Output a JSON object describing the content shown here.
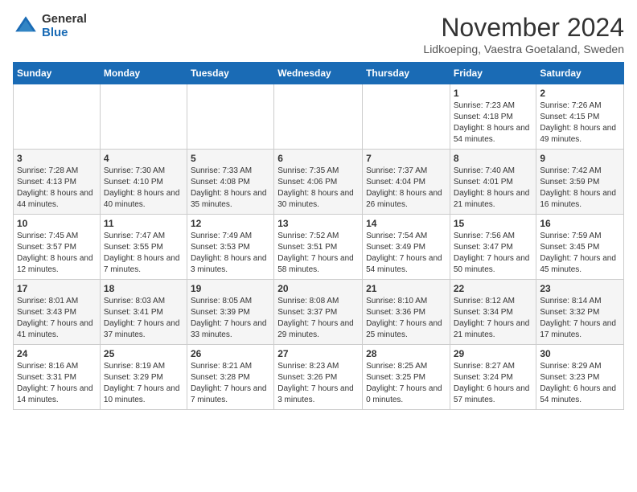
{
  "header": {
    "logo_general": "General",
    "logo_blue": "Blue",
    "title": "November 2024",
    "location": "Lidkoeping, Vaestra Goetaland, Sweden"
  },
  "weekdays": [
    "Sunday",
    "Monday",
    "Tuesday",
    "Wednesday",
    "Thursday",
    "Friday",
    "Saturday"
  ],
  "weeks": [
    [
      {
        "day": "",
        "info": ""
      },
      {
        "day": "",
        "info": ""
      },
      {
        "day": "",
        "info": ""
      },
      {
        "day": "",
        "info": ""
      },
      {
        "day": "",
        "info": ""
      },
      {
        "day": "1",
        "info": "Sunrise: 7:23 AM\nSunset: 4:18 PM\nDaylight: 8 hours and 54 minutes."
      },
      {
        "day": "2",
        "info": "Sunrise: 7:26 AM\nSunset: 4:15 PM\nDaylight: 8 hours and 49 minutes."
      }
    ],
    [
      {
        "day": "3",
        "info": "Sunrise: 7:28 AM\nSunset: 4:13 PM\nDaylight: 8 hours and 44 minutes."
      },
      {
        "day": "4",
        "info": "Sunrise: 7:30 AM\nSunset: 4:10 PM\nDaylight: 8 hours and 40 minutes."
      },
      {
        "day": "5",
        "info": "Sunrise: 7:33 AM\nSunset: 4:08 PM\nDaylight: 8 hours and 35 minutes."
      },
      {
        "day": "6",
        "info": "Sunrise: 7:35 AM\nSunset: 4:06 PM\nDaylight: 8 hours and 30 minutes."
      },
      {
        "day": "7",
        "info": "Sunrise: 7:37 AM\nSunset: 4:04 PM\nDaylight: 8 hours and 26 minutes."
      },
      {
        "day": "8",
        "info": "Sunrise: 7:40 AM\nSunset: 4:01 PM\nDaylight: 8 hours and 21 minutes."
      },
      {
        "day": "9",
        "info": "Sunrise: 7:42 AM\nSunset: 3:59 PM\nDaylight: 8 hours and 16 minutes."
      }
    ],
    [
      {
        "day": "10",
        "info": "Sunrise: 7:45 AM\nSunset: 3:57 PM\nDaylight: 8 hours and 12 minutes."
      },
      {
        "day": "11",
        "info": "Sunrise: 7:47 AM\nSunset: 3:55 PM\nDaylight: 8 hours and 7 minutes."
      },
      {
        "day": "12",
        "info": "Sunrise: 7:49 AM\nSunset: 3:53 PM\nDaylight: 8 hours and 3 minutes."
      },
      {
        "day": "13",
        "info": "Sunrise: 7:52 AM\nSunset: 3:51 PM\nDaylight: 7 hours and 58 minutes."
      },
      {
        "day": "14",
        "info": "Sunrise: 7:54 AM\nSunset: 3:49 PM\nDaylight: 7 hours and 54 minutes."
      },
      {
        "day": "15",
        "info": "Sunrise: 7:56 AM\nSunset: 3:47 PM\nDaylight: 7 hours and 50 minutes."
      },
      {
        "day": "16",
        "info": "Sunrise: 7:59 AM\nSunset: 3:45 PM\nDaylight: 7 hours and 45 minutes."
      }
    ],
    [
      {
        "day": "17",
        "info": "Sunrise: 8:01 AM\nSunset: 3:43 PM\nDaylight: 7 hours and 41 minutes."
      },
      {
        "day": "18",
        "info": "Sunrise: 8:03 AM\nSunset: 3:41 PM\nDaylight: 7 hours and 37 minutes."
      },
      {
        "day": "19",
        "info": "Sunrise: 8:05 AM\nSunset: 3:39 PM\nDaylight: 7 hours and 33 minutes."
      },
      {
        "day": "20",
        "info": "Sunrise: 8:08 AM\nSunset: 3:37 PM\nDaylight: 7 hours and 29 minutes."
      },
      {
        "day": "21",
        "info": "Sunrise: 8:10 AM\nSunset: 3:36 PM\nDaylight: 7 hours and 25 minutes."
      },
      {
        "day": "22",
        "info": "Sunrise: 8:12 AM\nSunset: 3:34 PM\nDaylight: 7 hours and 21 minutes."
      },
      {
        "day": "23",
        "info": "Sunrise: 8:14 AM\nSunset: 3:32 PM\nDaylight: 7 hours and 17 minutes."
      }
    ],
    [
      {
        "day": "24",
        "info": "Sunrise: 8:16 AM\nSunset: 3:31 PM\nDaylight: 7 hours and 14 minutes."
      },
      {
        "day": "25",
        "info": "Sunrise: 8:19 AM\nSunset: 3:29 PM\nDaylight: 7 hours and 10 minutes."
      },
      {
        "day": "26",
        "info": "Sunrise: 8:21 AM\nSunset: 3:28 PM\nDaylight: 7 hours and 7 minutes."
      },
      {
        "day": "27",
        "info": "Sunrise: 8:23 AM\nSunset: 3:26 PM\nDaylight: 7 hours and 3 minutes."
      },
      {
        "day": "28",
        "info": "Sunrise: 8:25 AM\nSunset: 3:25 PM\nDaylight: 7 hours and 0 minutes."
      },
      {
        "day": "29",
        "info": "Sunrise: 8:27 AM\nSunset: 3:24 PM\nDaylight: 6 hours and 57 minutes."
      },
      {
        "day": "30",
        "info": "Sunrise: 8:29 AM\nSunset: 3:23 PM\nDaylight: 6 hours and 54 minutes."
      }
    ]
  ]
}
